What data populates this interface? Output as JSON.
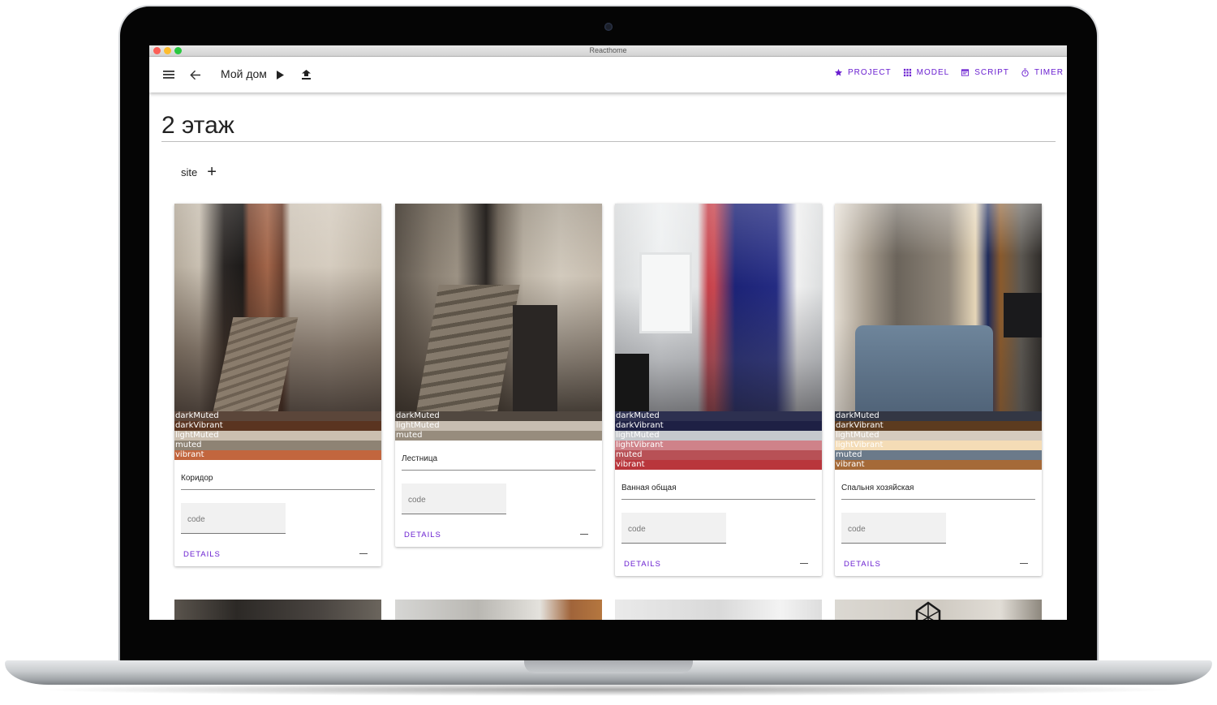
{
  "window": {
    "title": "Reacthome"
  },
  "header": {
    "project_name": "Мой дом",
    "nav": [
      {
        "icon": "star-icon",
        "label": "PROJECT"
      },
      {
        "icon": "grid-icon",
        "label": "MODEL"
      },
      {
        "icon": "script-icon",
        "label": "SCRIPT"
      },
      {
        "icon": "timer-icon",
        "label": "TIMER"
      }
    ]
  },
  "page": {
    "title": "2 этаж",
    "site_label": "site",
    "add_symbol": "+"
  },
  "cards": [
    {
      "name": "Коридор",
      "code_placeholder": "code",
      "details_label": "DETAILS",
      "swatches": [
        {
          "label": "darkMuted",
          "color": "#5b463a"
        },
        {
          "label": "darkVibrant",
          "color": "#5a3420"
        },
        {
          "label": "lightMuted",
          "color": "#cbbfb0"
        },
        {
          "label": "muted",
          "color": "#8e8374"
        },
        {
          "label": "vibrant",
          "color": "#c2663e"
        }
      ]
    },
    {
      "name": "Лестница",
      "code_placeholder": "code",
      "details_label": "DETAILS",
      "swatches": [
        {
          "label": "darkMuted",
          "color": "#514840"
        },
        {
          "label": "lightMuted",
          "color": "#c7bdb1"
        },
        {
          "label": "muted",
          "color": "#978c7d"
        }
      ]
    },
    {
      "name": "Ванная общая",
      "code_placeholder": "code",
      "details_label": "DETAILS",
      "swatches": [
        {
          "label": "darkMuted",
          "color": "#2d3050"
        },
        {
          "label": "darkVibrant",
          "color": "#1e2044"
        },
        {
          "label": "lightMuted",
          "color": "#c6c9cd"
        },
        {
          "label": "lightVibrant",
          "color": "#cf8289"
        },
        {
          "label": "muted",
          "color": "#b85156"
        },
        {
          "label": "vibrant",
          "color": "#b9363c"
        }
      ]
    },
    {
      "name": "Спальня хозяйская",
      "code_placeholder": "code",
      "details_label": "DETAILS",
      "swatches": [
        {
          "label": "darkMuted",
          "color": "#333744"
        },
        {
          "label": "darkVibrant",
          "color": "#5c3b1f"
        },
        {
          "label": "lightMuted",
          "color": "#d5cbbe"
        },
        {
          "label": "lightVibrant",
          "color": "#f4dcb6"
        },
        {
          "label": "muted",
          "color": "#6b7a8a"
        },
        {
          "label": "vibrant",
          "color": "#a56a38"
        }
      ]
    }
  ]
}
